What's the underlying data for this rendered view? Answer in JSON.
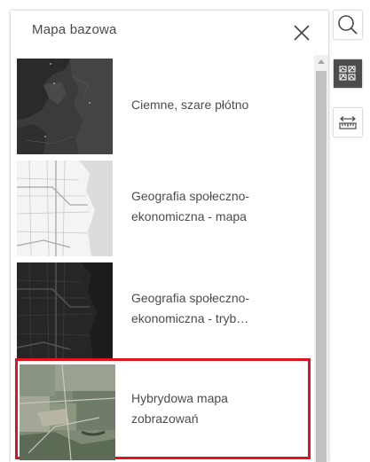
{
  "panel": {
    "title": "Mapa bazowa"
  },
  "gallery": {
    "items": [
      {
        "line1": "Ciemne, szare płótno",
        "line2": "",
        "selected": false
      },
      {
        "line1": "Geografia społeczno-",
        "line2": "ekonomiczna - mapa",
        "selected": false
      },
      {
        "line1": "Geografia społeczno-",
        "line2": "ekonomiczna - tryb…",
        "selected": false
      },
      {
        "line1": "Hybrydowa mapa",
        "line2": "zobrazowań",
        "selected": true
      }
    ]
  },
  "toolbar": {
    "tools": [
      {
        "icon": "search-icon",
        "active": false
      },
      {
        "icon": "basemap-gallery-icon",
        "active": true
      },
      {
        "icon": "measure-icon",
        "active": false
      }
    ]
  },
  "colors": {
    "selection": "#e0141e",
    "active_tool": "#4c4c4c"
  }
}
